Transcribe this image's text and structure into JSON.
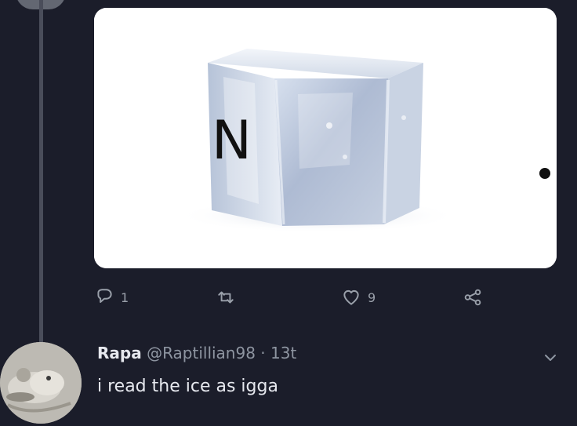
{
  "post": {
    "image": {
      "letter": "N",
      "punctuation": ".",
      "icon": "ice-cube-image"
    },
    "actions": {
      "reply_count": "1",
      "retweet_count": "",
      "like_count": "9"
    }
  },
  "reply": {
    "display_name": "Rapa",
    "handle": "@Raptillian98",
    "separator": "·",
    "time": "13t",
    "text": "i read the ice as igga"
  },
  "colors": {
    "background": "#1b1d2a",
    "text_primary": "#e6e8ee",
    "text_secondary": "#8e95a1"
  }
}
